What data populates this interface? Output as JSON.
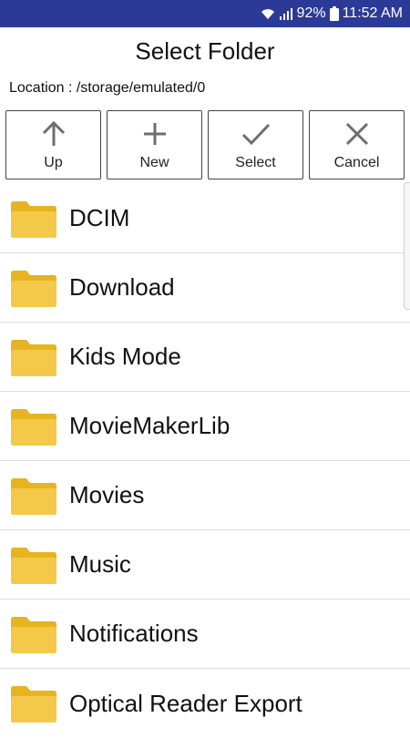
{
  "status": {
    "battery": "92%",
    "time": "11:52 AM"
  },
  "title": "Select Folder",
  "location": "Location : /storage/emulated/0",
  "toolbar": {
    "up_label": "Up",
    "new_label": "New",
    "select_label": "Select",
    "cancel_label": "Cancel"
  },
  "folders": [
    "DCIM",
    "Download",
    "Kids Mode",
    "MovieMakerLib",
    "Movies",
    "Music",
    "Notifications",
    "Optical Reader Export"
  ],
  "colors": {
    "status_bar": "#2c3a97",
    "folder_back": "#e6b420",
    "folder_front": "#f4c94a",
    "icon_gray": "#6e6e6e"
  }
}
